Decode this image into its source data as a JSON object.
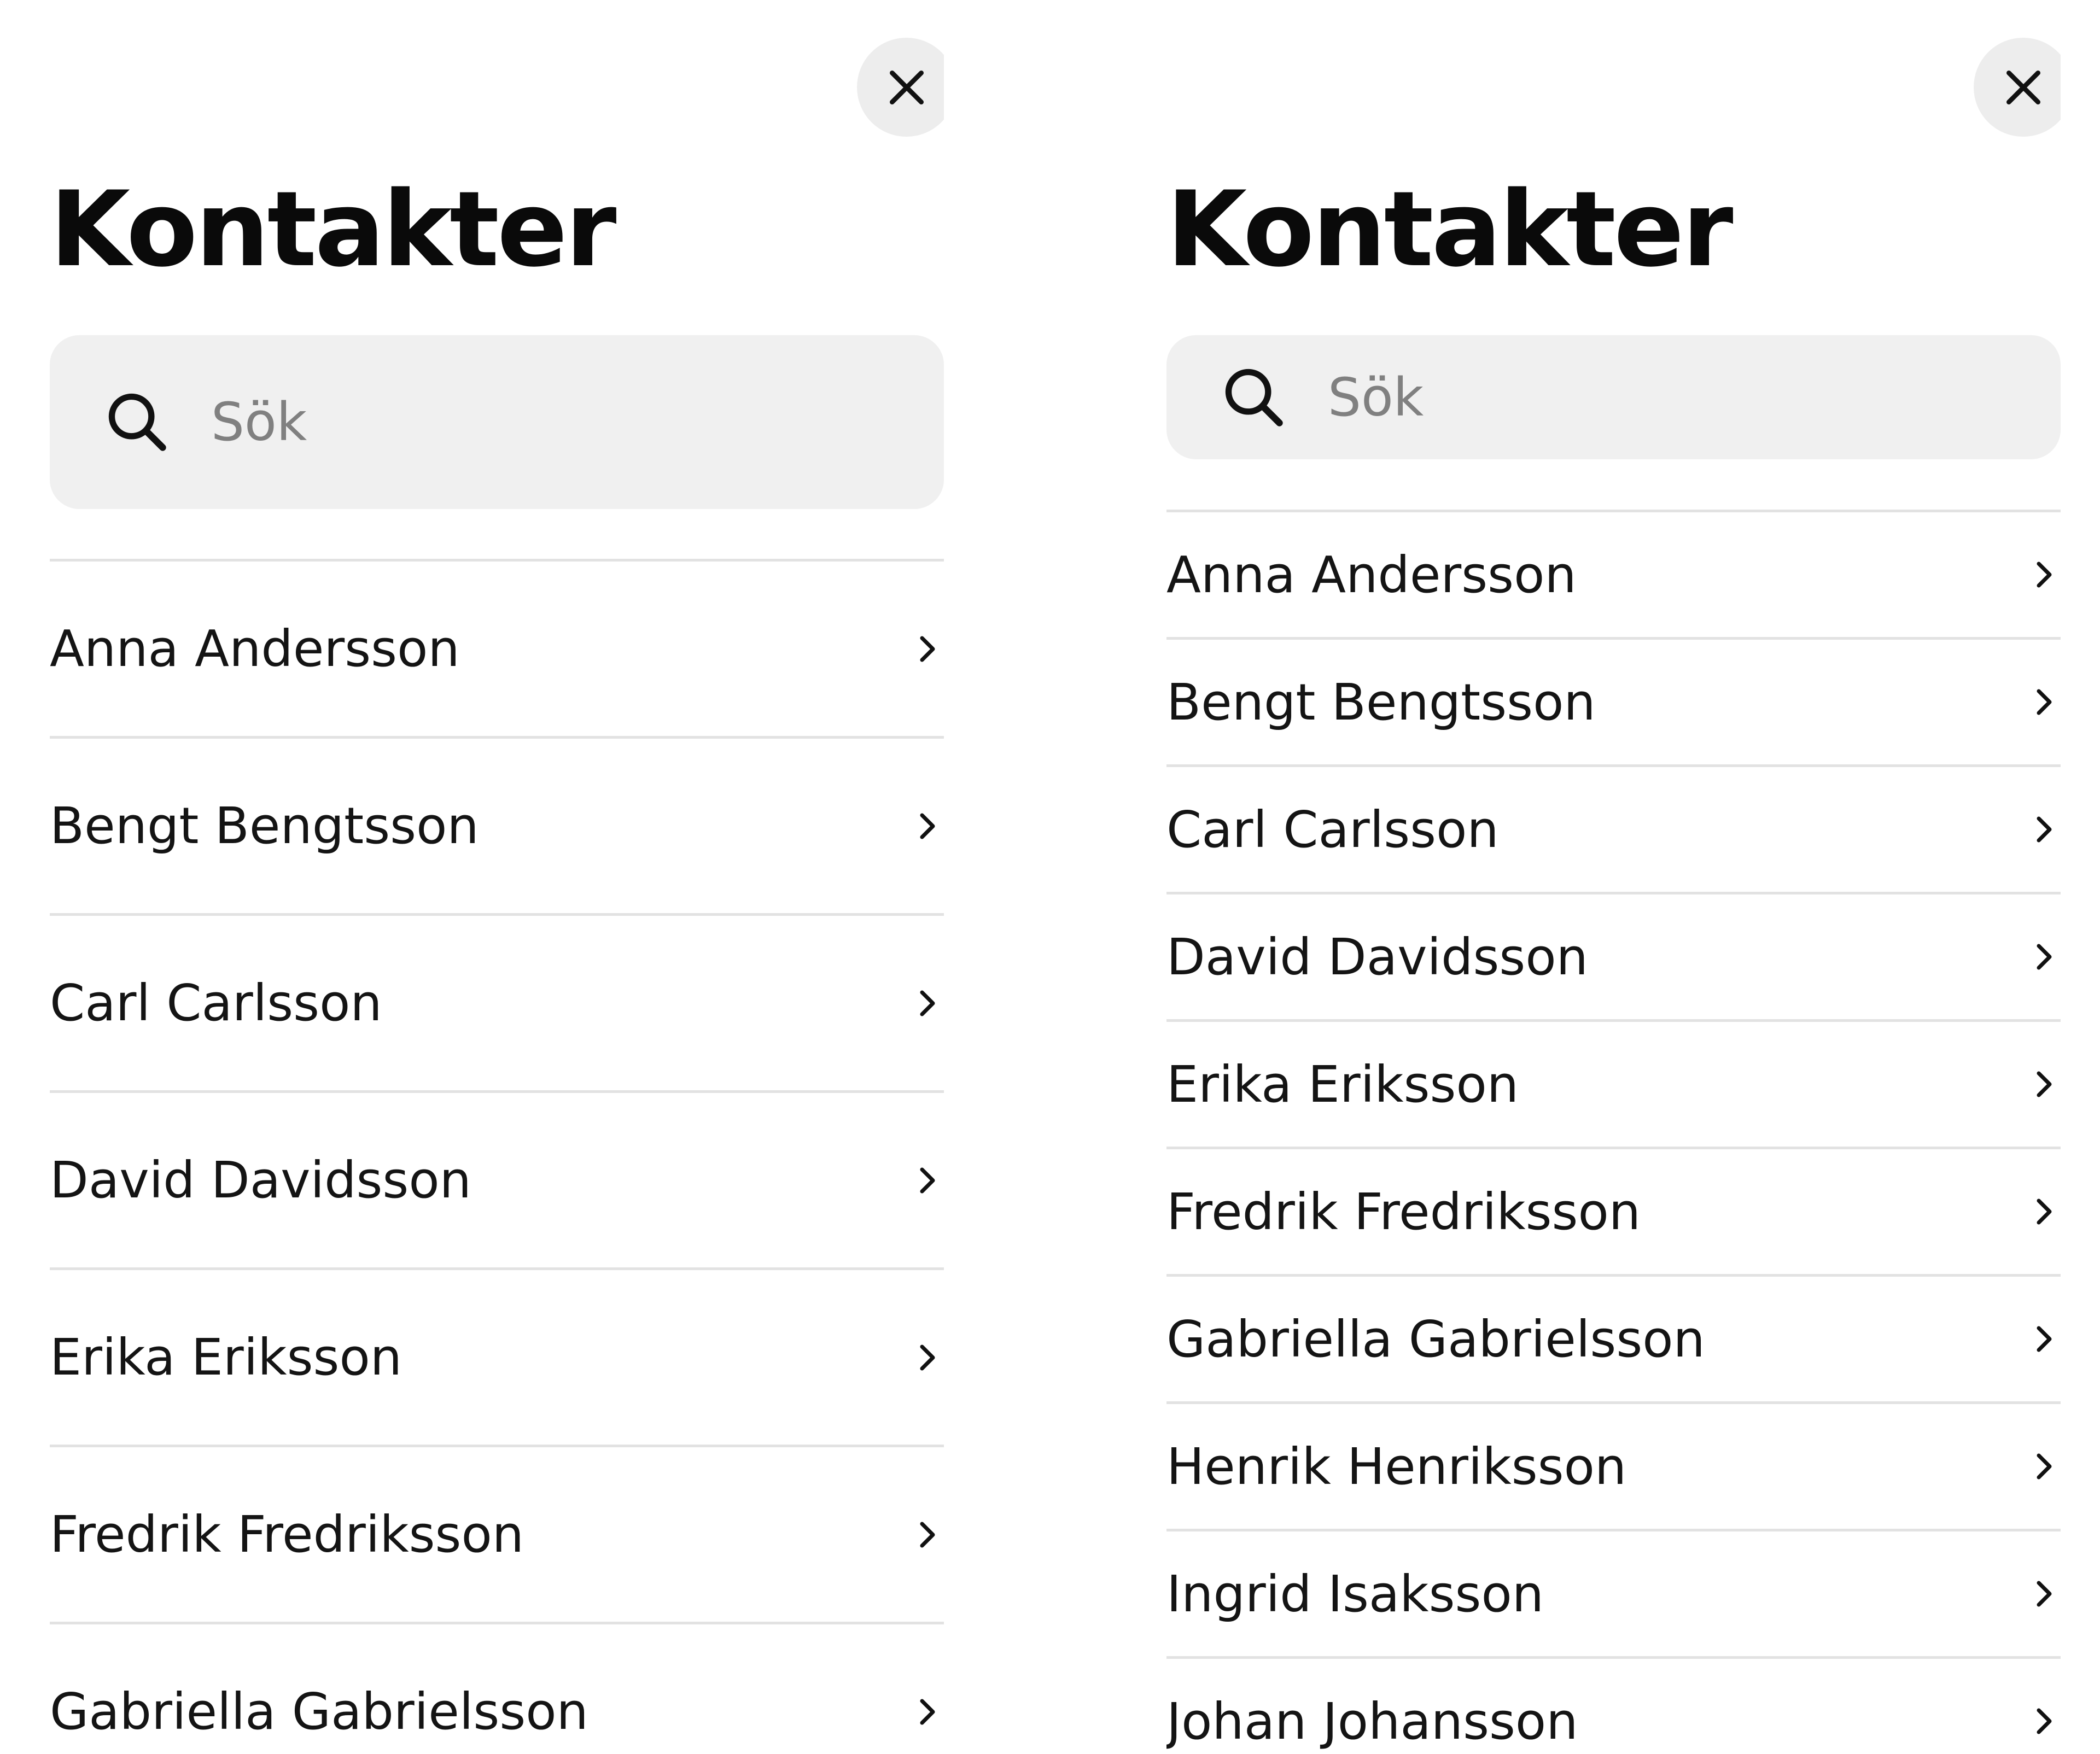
{
  "screens": [
    {
      "close_icon": "close-icon",
      "title": "Kontakter",
      "search": {
        "placeholder": "Sök",
        "value": "",
        "icon": "search-icon"
      },
      "contacts": [
        "Anna Andersson",
        "Bengt Bengtsson",
        "Carl Carlsson",
        "David Davidsson",
        "Erika Eriksson",
        "Fredrik Fredriksson",
        "Gabriella Gabrielsson"
      ]
    },
    {
      "close_icon": "close-icon",
      "title": "Kontakter",
      "search": {
        "placeholder": "Sök",
        "value": "",
        "icon": "search-icon"
      },
      "contacts": [
        "Anna Andersson",
        "Bengt Bengtsson",
        "Carl Carlsson",
        "David Davidsson",
        "Erika Eriksson",
        "Fredrik Fredriksson",
        "Gabriella Gabrielsson",
        "Henrik Henriksson",
        "Ingrid Isaksson",
        "Johan Johansson"
      ]
    }
  ]
}
